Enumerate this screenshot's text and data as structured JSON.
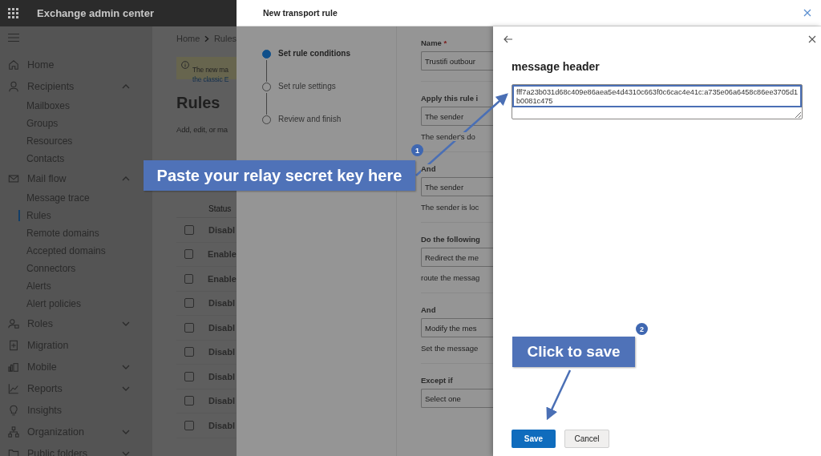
{
  "app": {
    "title": "Exchange admin center"
  },
  "sidebar": {
    "items": [
      {
        "label": "Home",
        "selected": false
      },
      {
        "label": "Recipients",
        "selected": false,
        "expanded": true,
        "children": [
          {
            "label": "Mailboxes",
            "selected": false
          },
          {
            "label": "Groups",
            "selected": false
          },
          {
            "label": "Resources",
            "selected": false
          },
          {
            "label": "Contacts",
            "selected": false
          }
        ]
      },
      {
        "label": "Mail flow",
        "selected": false,
        "expanded": true,
        "children": [
          {
            "label": "Message trace",
            "selected": false
          },
          {
            "label": "Rules",
            "selected": true
          },
          {
            "label": "Remote domains",
            "selected": false
          },
          {
            "label": "Accepted domains",
            "selected": false
          },
          {
            "label": "Connectors",
            "selected": false
          },
          {
            "label": "Alerts",
            "selected": false
          },
          {
            "label": "Alert policies",
            "selected": false
          }
        ]
      },
      {
        "label": "Roles",
        "selected": false,
        "expanded": false
      },
      {
        "label": "Migration",
        "selected": false
      },
      {
        "label": "Mobile",
        "selected": false,
        "expanded": false
      },
      {
        "label": "Reports",
        "selected": false,
        "expanded": false
      },
      {
        "label": "Insights",
        "selected": false
      },
      {
        "label": "Organization",
        "selected": false,
        "expanded": false
      },
      {
        "label": "Public folders",
        "selected": false,
        "expanded": false
      }
    ]
  },
  "breadcrumb": [
    "Home",
    "Rules"
  ],
  "banner": {
    "text": "The new ma",
    "link": "the classic E"
  },
  "page": {
    "title": "Rules",
    "description": "Add, edit, or ma"
  },
  "table": {
    "columns": [
      "Status"
    ],
    "rows": [
      {
        "status": "Disabl",
        "checked": false
      },
      {
        "status": "Enable",
        "checked": false
      },
      {
        "status": "Enable",
        "checked": false
      },
      {
        "status": "Disabl",
        "checked": false
      },
      {
        "status": "Disabl",
        "checked": false
      },
      {
        "status": "Disabl",
        "checked": false
      },
      {
        "status": "Disabl",
        "checked": false
      },
      {
        "status": "Disabl",
        "checked": false
      },
      {
        "status": "Disabl",
        "checked": false
      }
    ]
  },
  "panel": {
    "title": "New transport rule",
    "steps": [
      {
        "label": "Set rule conditions",
        "selected": true
      },
      {
        "label": "Set rule settings",
        "selected": false
      },
      {
        "label": "Review and finish",
        "selected": false
      }
    ],
    "form": [
      {
        "label": "Name",
        "required_mark": "*",
        "value": "Trustifi outbour"
      },
      {
        "label": "Apply this rule i",
        "value": "The sender",
        "hint": "The sender's do"
      },
      {
        "label": "And",
        "value": "The sender",
        "hint": "The sender is loc"
      },
      {
        "label": "Do the following",
        "value": "Redirect the me",
        "hint": "route the messag"
      },
      {
        "label": "And",
        "value": "Modify the mes",
        "hint": "Set the message"
      },
      {
        "label": "Except if",
        "value": "Select one"
      }
    ]
  },
  "flyout": {
    "title": "message header",
    "value": "fff7a23b031d68c409e86aea5e4d4310c663f0c6cac4e41c:a735e06a6458c86ee3705d1b0081c475",
    "buttons": [
      {
        "label": "Save",
        "kind": "primary"
      },
      {
        "label": "Cancel",
        "kind": "secondary"
      }
    ]
  },
  "callouts": [
    {
      "number": "1",
      "text": "Paste your relay secret key here"
    },
    {
      "number": "2",
      "text": "Click to save"
    }
  ]
}
